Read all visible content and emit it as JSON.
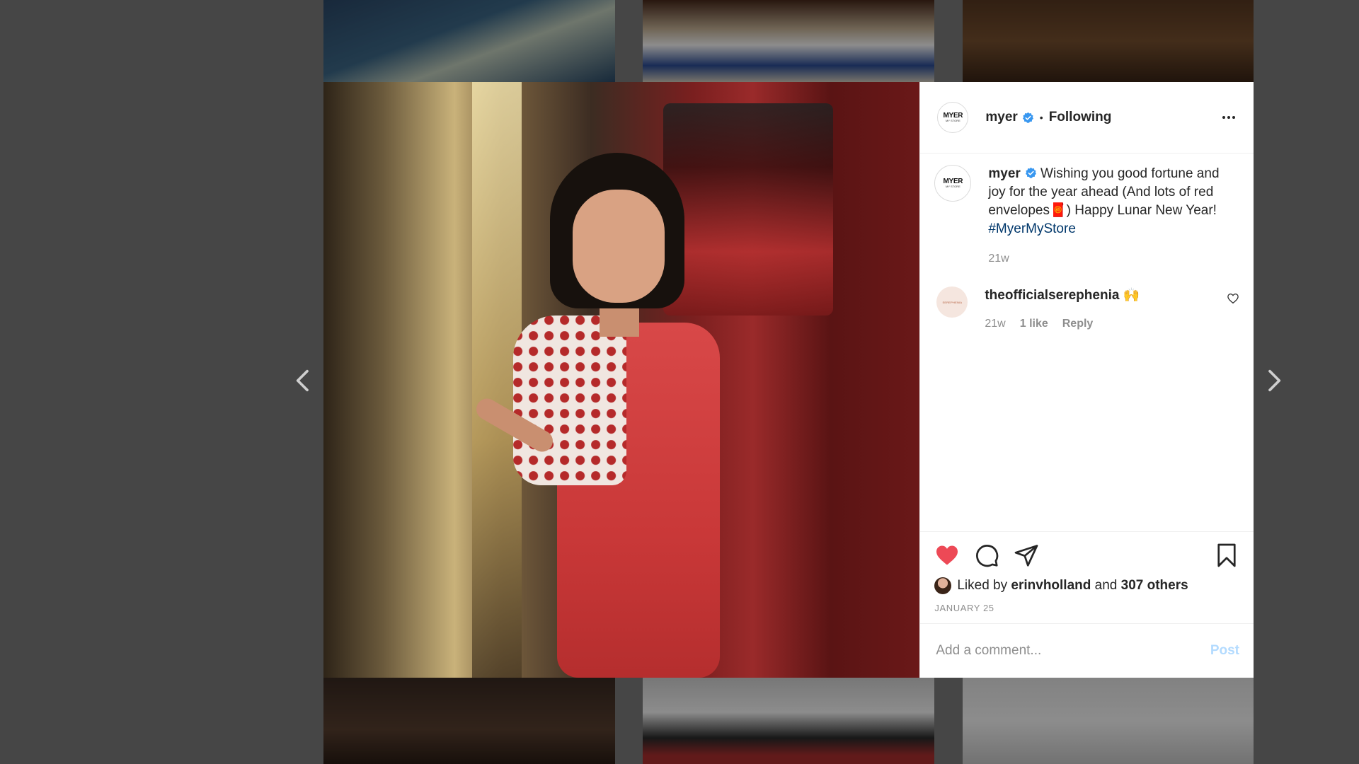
{
  "post": {
    "username": "myer",
    "follow_separator": "•",
    "follow_status": "Following",
    "avatar_logo": "MYER",
    "avatar_sub": "MY STORE"
  },
  "caption": {
    "username": "myer",
    "text_before_emoji": " Wishing you good fortune and joy for the year ahead (And lots of red envelopes",
    "emoji": "🧧",
    "text_after_emoji": ") Happy Lunar New Year! ",
    "hashtag": "#MyerMyStore",
    "age": "21w"
  },
  "comments": [
    {
      "username": "theofficialserephenia",
      "emoji": "🙌",
      "avatar_text": "SEREPHENIA",
      "age": "21w",
      "likes": "1 like",
      "reply": "Reply"
    }
  ],
  "actions": {
    "liked_prefix": "Liked by ",
    "liked_user": "erinvholland",
    "liked_and": " and ",
    "liked_others": "307 others",
    "date": "JANUARY 25"
  },
  "add_comment": {
    "placeholder": "Add a comment...",
    "post_label": "Post"
  },
  "colors": {
    "like_heart": "#ed4956",
    "verified": "#3897f0",
    "hashtag": "#00376b",
    "post_button_disabled": "#b3dbff"
  }
}
